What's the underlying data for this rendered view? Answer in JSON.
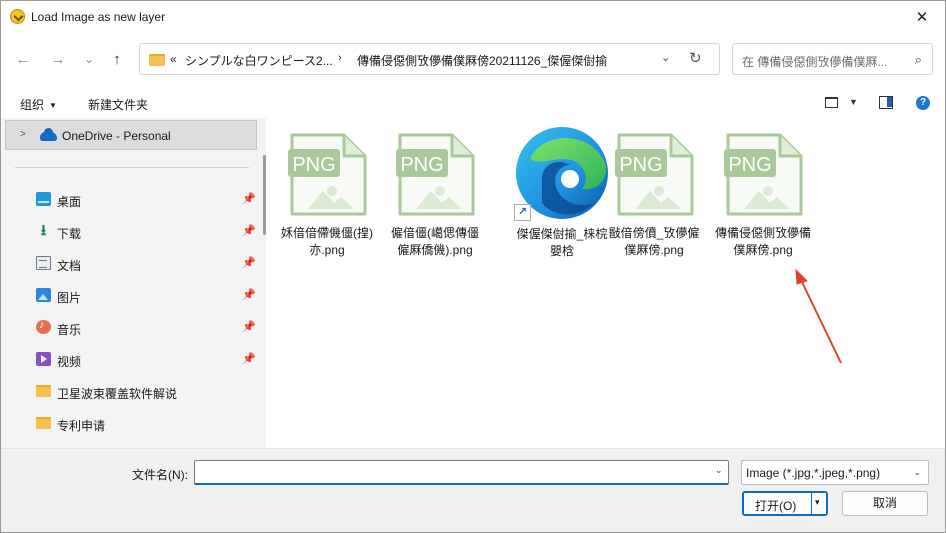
{
  "window": {
    "title": "Load Image as new layer",
    "close_glyph": "✕"
  },
  "nav": {
    "back": "←",
    "forward": "→",
    "recent": "⌄",
    "up": "↑"
  },
  "address": {
    "crumbs": [
      "«",
      "シンプルな白ワンピース2...",
      "傳備侵僫側攷儚備僕厤傍20211126_傑偓傑傠揄"
    ],
    "separator": "›",
    "dropdown": "⌄",
    "refresh": "↻"
  },
  "search": {
    "placeholder": "在 傳備侵僫側攷儚備僕厤...",
    "icon": "⌕"
  },
  "toolbar": {
    "organize": "组织",
    "organize_caret": "▼",
    "new_folder": "新建文件夹",
    "view_caret": "▼",
    "help": "?"
  },
  "sidebar": {
    "onedrive": {
      "expander": ">",
      "label": "OneDrive - Personal"
    },
    "pin": "📌",
    "items": [
      {
        "label": "桌面",
        "pinned": true
      },
      {
        "label": "下载",
        "pinned": true
      },
      {
        "label": "文档",
        "pinned": true
      },
      {
        "label": "图片",
        "pinned": true
      },
      {
        "label": "音乐",
        "pinned": true
      },
      {
        "label": "视频",
        "pinned": true
      },
      {
        "label": "卫星波束覆盖软件解说",
        "pinned": false
      },
      {
        "label": "专利申请",
        "pinned": false
      }
    ]
  },
  "files": [
    {
      "name": "姀偣偣僀僟僵(揘)亦.png",
      "icon_label": "PNG"
    },
    {
      "name": "僱偣僵(嶱偲傳僵僱厤僑僟).png",
      "icon_label": "PNG"
    },
    {
      "name": "傑偓傑傠揄_梾梡嬰梒",
      "shortcut_glyph": "↗"
    },
    {
      "name": "敯偣傍僨_攷儚僱僕厤傍.png",
      "icon_label": "PNG"
    },
    {
      "name": "傳備侵僫側攷儚備僕厤傍.png",
      "icon_label": "PNG"
    }
  ],
  "bottom": {
    "filename_label": "文件名(N):",
    "filename_value": "",
    "filename_caret": "⌄",
    "filter_value": "Image (*.jpg,*.jpeg,*.png)",
    "filter_caret": "⌄",
    "open_label": "打开(O)",
    "open_caret": "▾",
    "cancel_label": "取消"
  },
  "colors": {
    "accent": "#0f6cbd",
    "png_icon": "#a9c99a",
    "annotation_arrow": "#d9472b"
  }
}
